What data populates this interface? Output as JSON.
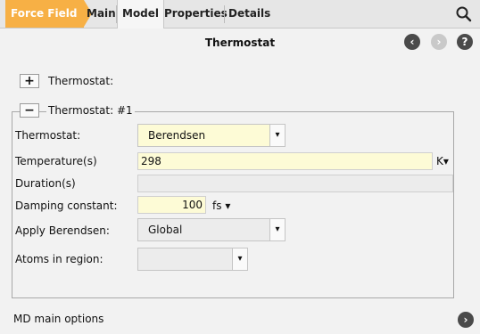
{
  "tabs": {
    "force_field": "Force Field",
    "main": "Main",
    "model": "Model",
    "properties": "Properties",
    "details": "Details"
  },
  "header": {
    "title": "Thermostat"
  },
  "sections": {
    "add_label": "Thermostat:",
    "group_label": "Thermostat: #1"
  },
  "form": {
    "thermostat_label": "Thermostat:",
    "thermostat_value": "Berendsen",
    "temperature_label": "Temperature(s)",
    "temperature_value": "298",
    "temperature_unit": "K",
    "duration_label": "Duration(s)",
    "duration_value": "",
    "damping_label": "Damping constant:",
    "damping_value": "100",
    "damping_unit": "fs",
    "apply_label": "Apply Berendsen:",
    "apply_value": "Global",
    "atoms_label": "Atoms in region:",
    "atoms_value": ""
  },
  "footer": {
    "label": "MD main options"
  },
  "icons": {
    "plus": "+",
    "minus": "−",
    "back": "‹",
    "forward": "›",
    "help": "?",
    "dropdown": "▾"
  },
  "colors": {
    "accent": "#f7b045",
    "field_bg": "#fdfbd6"
  }
}
